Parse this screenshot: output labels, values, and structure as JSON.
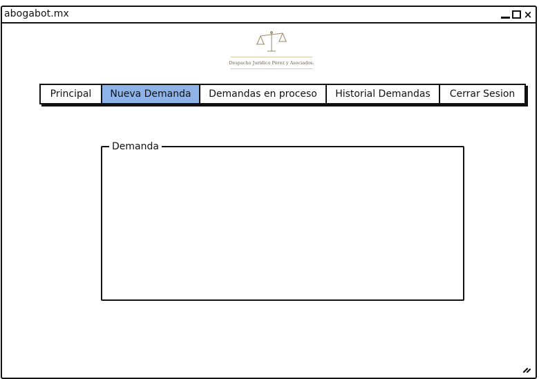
{
  "window": {
    "title": "abogabot.mx",
    "controls": {
      "minimize": "minimize-icon",
      "maximize": "maximize-icon",
      "close": "close-icon",
      "close_glyph": "×"
    }
  },
  "logo": {
    "icon": "scales-of-justice-icon",
    "text": "Despacho Jurídico Pérez y Asociados."
  },
  "nav": {
    "tabs": [
      {
        "label": "Principal",
        "active": false
      },
      {
        "label": "Nueva Demanda",
        "active": true
      },
      {
        "label": "Demandas en proceso",
        "active": false
      },
      {
        "label": "Historial Demandas",
        "active": false
      },
      {
        "label": "Cerrar Sesion",
        "active": false
      }
    ],
    "active_color": "#8db3e9"
  },
  "demanda": {
    "legend": "Demanda"
  }
}
